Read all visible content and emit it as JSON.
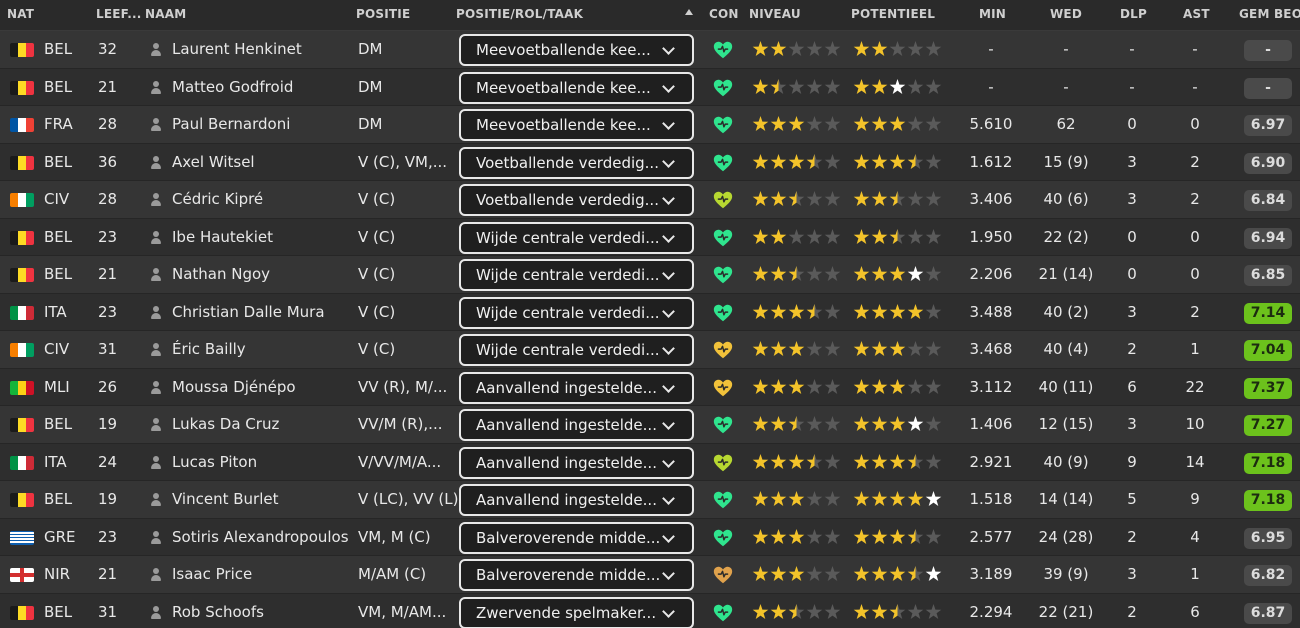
{
  "columns": {
    "nat": "NAT",
    "age": "LEEF...",
    "name": "NAAM",
    "position": "POSITIE",
    "role": "POSITIE/ROL/TAAK",
    "con": "CON",
    "level": "NIVEAU",
    "potential": "POTENTIEEL",
    "min": "MIN",
    "wed": "WED",
    "dlp": "DLP",
    "ast": "AST",
    "rating": "GEM BEO"
  },
  "colors": {
    "heart_green": "#2fe58e",
    "heart_yellowgreen": "#b7d831",
    "heart_yellow": "#f2c23a",
    "heart_orange": "#e0a24c",
    "star_gold": "#f3c32a",
    "star_white": "#ffffff",
    "star_empty": "#5a5a5a",
    "badge_green": "#6cc21c",
    "badge_grey": "#4a4a4a"
  },
  "players": [
    {
      "nat": "BEL",
      "flag": "bel",
      "age": "32",
      "name": "Laurent Henkinet",
      "position": "DM",
      "role": "Meevoetballende kee...",
      "con": "green",
      "level": 2,
      "potential": 2,
      "potential_max": 2,
      "min": "-",
      "wed": "-",
      "dlp": "-",
      "ast": "-",
      "rating": "-",
      "rating_style": "grey"
    },
    {
      "nat": "BEL",
      "flag": "bel",
      "age": "21",
      "name": "Matteo Godfroid",
      "position": "DM",
      "role": "Meevoetballende kee...",
      "con": "green",
      "level": 1.5,
      "potential": 2,
      "potential_max": 2.5,
      "min": "-",
      "wed": "-",
      "dlp": "-",
      "ast": "-",
      "rating": "-",
      "rating_style": "grey"
    },
    {
      "nat": "FRA",
      "flag": "fra",
      "age": "28",
      "name": "Paul Bernardoni",
      "position": "DM",
      "role": "Meevoetballende kee...",
      "con": "green",
      "level": 3,
      "potential": 3,
      "potential_max": 3,
      "min": "5.610",
      "wed": "62",
      "dlp": "0",
      "ast": "0",
      "rating": "6.97",
      "rating_style": "grey"
    },
    {
      "nat": "BEL",
      "flag": "bel",
      "age": "36",
      "name": "Axel Witsel",
      "position": "V (C), VM,...",
      "role": "Voetballende verdedig...",
      "con": "green",
      "level": 3.5,
      "potential": 3.5,
      "potential_max": 3.5,
      "min": "1.612",
      "wed": "15 (9)",
      "dlp": "3",
      "ast": "2",
      "rating": "6.90",
      "rating_style": "grey"
    },
    {
      "nat": "CIV",
      "flag": "civ",
      "age": "28",
      "name": "Cédric Kipré",
      "position": "V (C)",
      "role": "Voetballende verdedig...",
      "con": "yellowgreen",
      "level": 2.5,
      "potential": 2.5,
      "potential_max": 2.5,
      "min": "3.406",
      "wed": "40 (6)",
      "dlp": "3",
      "ast": "2",
      "rating": "6.84",
      "rating_style": "grey"
    },
    {
      "nat": "BEL",
      "flag": "bel",
      "age": "23",
      "name": "Ibe Hautekiet",
      "position": "V (C)",
      "role": "Wijde centrale verdedi...",
      "con": "green",
      "level": 2,
      "potential": 2.5,
      "potential_max": 2.5,
      "min": "1.950",
      "wed": "22 (2)",
      "dlp": "0",
      "ast": "0",
      "rating": "6.94",
      "rating_style": "grey"
    },
    {
      "nat": "BEL",
      "flag": "bel",
      "age": "21",
      "name": "Nathan Ngoy",
      "position": "V (C)",
      "role": "Wijde centrale verdedi...",
      "con": "green",
      "level": 2.5,
      "potential": 3,
      "potential_max": 4,
      "min": "2.206",
      "wed": "21 (14)",
      "dlp": "0",
      "ast": "0",
      "rating": "6.85",
      "rating_style": "grey"
    },
    {
      "nat": "ITA",
      "flag": "ita",
      "age": "23",
      "name": "Christian Dalle Mura",
      "position": "V (C)",
      "role": "Wijde centrale verdedi...",
      "con": "green",
      "level": 3.5,
      "potential": 4,
      "potential_max": 4,
      "min": "3.488",
      "wed": "40 (2)",
      "dlp": "3",
      "ast": "2",
      "rating": "7.14",
      "rating_style": "green"
    },
    {
      "nat": "CIV",
      "flag": "civ",
      "age": "31",
      "name": "Éric Bailly",
      "position": "V (C)",
      "role": "Wijde centrale verdedi...",
      "con": "yellow",
      "level": 3,
      "potential": 3,
      "potential_max": 3,
      "min": "3.468",
      "wed": "40 (4)",
      "dlp": "2",
      "ast": "1",
      "rating": "7.04",
      "rating_style": "green"
    },
    {
      "nat": "MLI",
      "flag": "mli",
      "age": "26",
      "name": "Moussa Djénépo",
      "position": "VV (R), M/...",
      "role": "Aanvallend ingestelde...",
      "con": "yellow",
      "level": 3,
      "potential": 3,
      "potential_max": 3,
      "min": "3.112",
      "wed": "40 (11)",
      "dlp": "6",
      "ast": "22",
      "rating": "7.37",
      "rating_style": "green"
    },
    {
      "nat": "BEL",
      "flag": "bel",
      "age": "19",
      "name": "Lukas Da Cruz",
      "position": "VV/M (R),...",
      "role": "Aanvallend ingestelde...",
      "con": "green",
      "level": 2.5,
      "potential": 3,
      "potential_max": 4,
      "min": "1.406",
      "wed": "12 (15)",
      "dlp": "3",
      "ast": "10",
      "rating": "7.27",
      "rating_style": "green"
    },
    {
      "nat": "ITA",
      "flag": "ita",
      "age": "24",
      "name": "Lucas Piton",
      "position": "V/VV/M/A...",
      "role": "Aanvallend ingestelde...",
      "con": "yellowgreen",
      "level": 3.5,
      "potential": 3.5,
      "potential_max": 3.5,
      "min": "2.921",
      "wed": "40 (9)",
      "dlp": "9",
      "ast": "14",
      "rating": "7.18",
      "rating_style": "green"
    },
    {
      "nat": "BEL",
      "flag": "bel",
      "age": "19",
      "name": "Vincent Burlet",
      "position": "V (LC), VV (L)",
      "role": "Aanvallend ingestelde...",
      "con": "green",
      "level": 3,
      "potential": 4,
      "potential_max": 5,
      "min": "1.518",
      "wed": "14 (14)",
      "dlp": "5",
      "ast": "9",
      "rating": "7.18",
      "rating_style": "green"
    },
    {
      "nat": "GRE",
      "flag": "gre",
      "age": "23",
      "name": "Sotiris Alexandropoulos",
      "position": "VM, M (C)",
      "role": "Balveroverende midde...",
      "con": "green",
      "level": 3,
      "potential": 3.5,
      "potential_max": 3.5,
      "min": "2.577",
      "wed": "24 (28)",
      "dlp": "2",
      "ast": "4",
      "rating": "6.95",
      "rating_style": "grey"
    },
    {
      "nat": "NIR",
      "flag": "nir",
      "age": "21",
      "name": "Isaac Price",
      "position": "M/AM (C)",
      "role": "Balveroverende midde...",
      "con": "orange",
      "level": 3,
      "potential": 3.5,
      "potential_max": 4.5,
      "min": "3.189",
      "wed": "39 (9)",
      "dlp": "3",
      "ast": "1",
      "rating": "6.82",
      "rating_style": "grey"
    },
    {
      "nat": "BEL",
      "flag": "bel",
      "age": "31",
      "name": "Rob Schoofs",
      "position": "VM, M/AM...",
      "role": "Zwervende spelmaker...",
      "con": "green",
      "level": 2.5,
      "potential": 2.5,
      "potential_max": 2.5,
      "min": "2.294",
      "wed": "22 (21)",
      "dlp": "2",
      "ast": "6",
      "rating": "6.87",
      "rating_style": "grey"
    }
  ]
}
